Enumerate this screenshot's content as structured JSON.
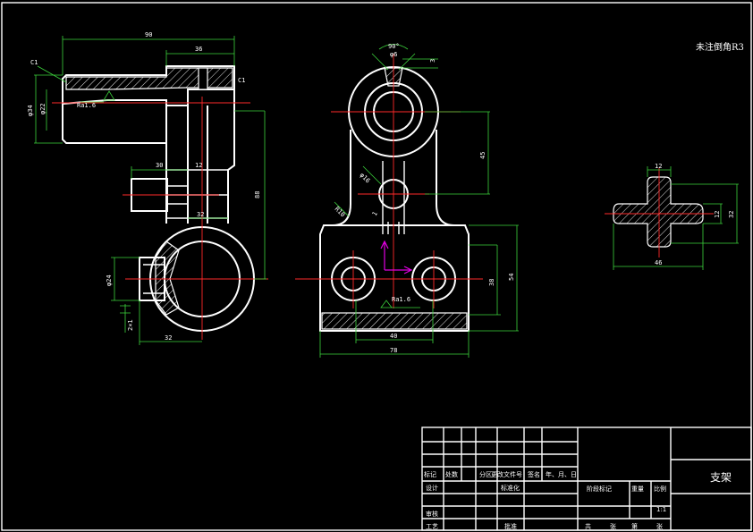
{
  "drawing": {
    "note": "未注倒角R3",
    "colors": {
      "background": "#000000",
      "outline": "#ffffff",
      "center": "#ff2a2a",
      "dimension": "#3cd23c",
      "axis": "#e000e0"
    }
  },
  "view_left": {
    "dims": {
      "d90": "90",
      "d36": "36",
      "c1a": "C1",
      "c1b": "C1",
      "phi34": "φ34",
      "phi22": "φ22",
      "ra": "Ra1.6",
      "d30": "30",
      "d12": "12",
      "d88": "88",
      "d32a": "32",
      "d24": "φ24",
      "d2x1": "2×1",
      "d32b": "32"
    }
  },
  "view_front": {
    "dims": {
      "d90deg": "90°",
      "d6": "φ6",
      "d3": "3",
      "d45": "45",
      "d16": "φ16",
      "r10": "R10",
      "d1": "1",
      "ra": "Ra1.6",
      "d38": "38",
      "d54": "54",
      "d40": "40",
      "d78": "78"
    }
  },
  "view_section": {
    "dims": {
      "d12a": "12",
      "d12b": "12",
      "d32": "32",
      "d46": "46"
    }
  },
  "title_block": {
    "part_name": "支架",
    "rev_headers": [
      "标记",
      "处数",
      "分区",
      "更改文件号",
      "签名",
      "年、月、日"
    ],
    "row_design": "设计",
    "row_standard": "标准化",
    "row_review": "审核",
    "row_process": "工艺",
    "row_approve": "批准",
    "stage_label": "阶段标记",
    "weight_label": "重量",
    "ratio_label": "比例",
    "ratio_value": "1:1",
    "sheet_labels": [
      "共",
      "张",
      "第",
      "张"
    ]
  }
}
